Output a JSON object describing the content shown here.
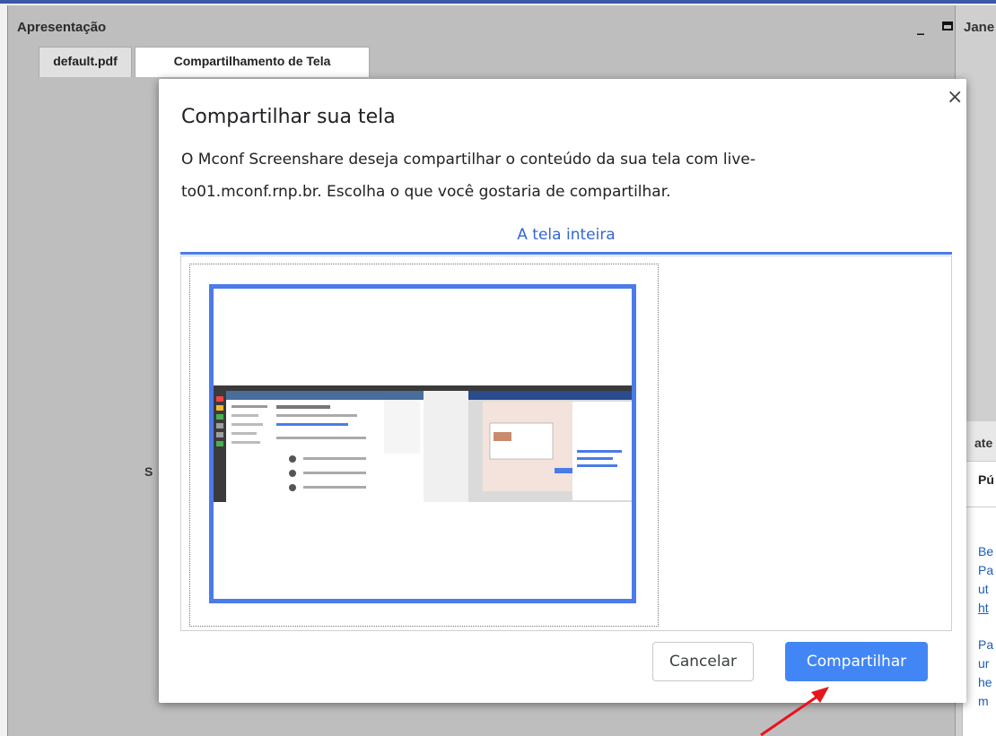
{
  "presentation_window": {
    "title": "Apresentação",
    "tabs": [
      {
        "label": "default.pdf"
      },
      {
        "label": "Compartilhamento de Tela"
      }
    ],
    "peek_text": "S"
  },
  "right_window": {
    "title": "Jane",
    "chat_header": "ate",
    "chat_tab": "Pú",
    "chat_lines": [
      "Be",
      "Pa",
      "ut",
      "ht",
      "Pa",
      "ur",
      "he",
      "m"
    ]
  },
  "dialog": {
    "title": "Compartilhar sua tela",
    "description_line1": "O Mconf Screenshare deseja compartilhar o conteúdo da sua tela com live-",
    "description_line2": "to01.mconf.rnp.br. Escolha o que você gostaria de compartilhar.",
    "tab_label": "A tela inteira",
    "cancel_label": "Cancelar",
    "share_label": "Compartilhar",
    "close_glyph": "×"
  },
  "colors": {
    "accent": "#4286f5",
    "tab_text": "#3367d6",
    "arrow": "#e8141b"
  }
}
